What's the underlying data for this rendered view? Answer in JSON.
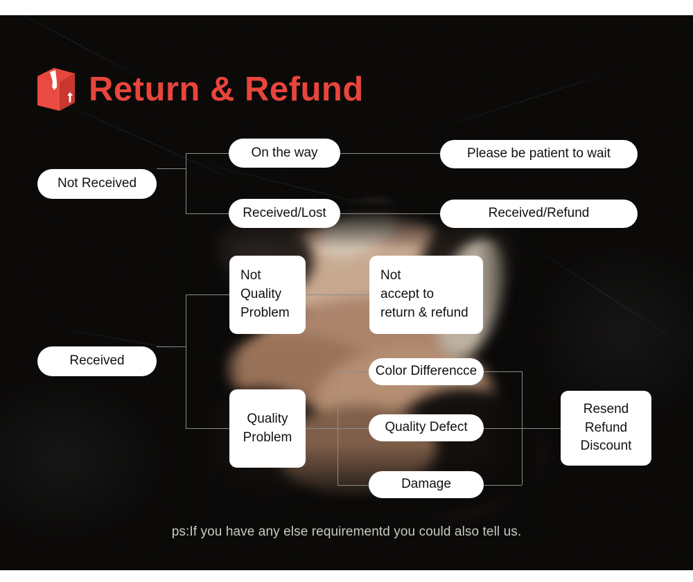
{
  "header": {
    "title": "Return & Refund",
    "icon": "package-box-icon",
    "accent_color": "#e8453c"
  },
  "theme": {
    "background_color": "#0b0a09",
    "node_background": "#ffffff",
    "node_text_color": "#111111",
    "connector_color": "#8d8d8a",
    "footnote_color": "#c9c9c6"
  },
  "flow": {
    "roots": [
      {
        "id": "not-received",
        "label": "Not Received"
      },
      {
        "id": "received",
        "label": "Received"
      }
    ],
    "level2": [
      {
        "id": "on-the-way",
        "label": "On the way"
      },
      {
        "id": "received-lost",
        "label": "Received/Lost"
      },
      {
        "id": "not-quality-problem",
        "label": "Not\nQuality\nProblem"
      },
      {
        "id": "quality-problem",
        "label": "Quality\nProblem"
      }
    ],
    "level3": [
      {
        "id": "please-be-patient",
        "label": "Please be patient to wait"
      },
      {
        "id": "received-refund",
        "label": "Received/Refund"
      },
      {
        "id": "not-accept",
        "label": "Not\naccept to\nreturn & refund"
      },
      {
        "id": "color-difference",
        "label": "Color Differencce"
      },
      {
        "id": "quality-defect",
        "label": "Quality Defect"
      },
      {
        "id": "damage",
        "label": "Damage"
      }
    ],
    "level4": [
      {
        "id": "resend-refund-discount",
        "label": "Resend\nRefund\nDiscount"
      }
    ]
  },
  "footer": {
    "note": "ps:If you have any else requirementd you could also tell us."
  }
}
